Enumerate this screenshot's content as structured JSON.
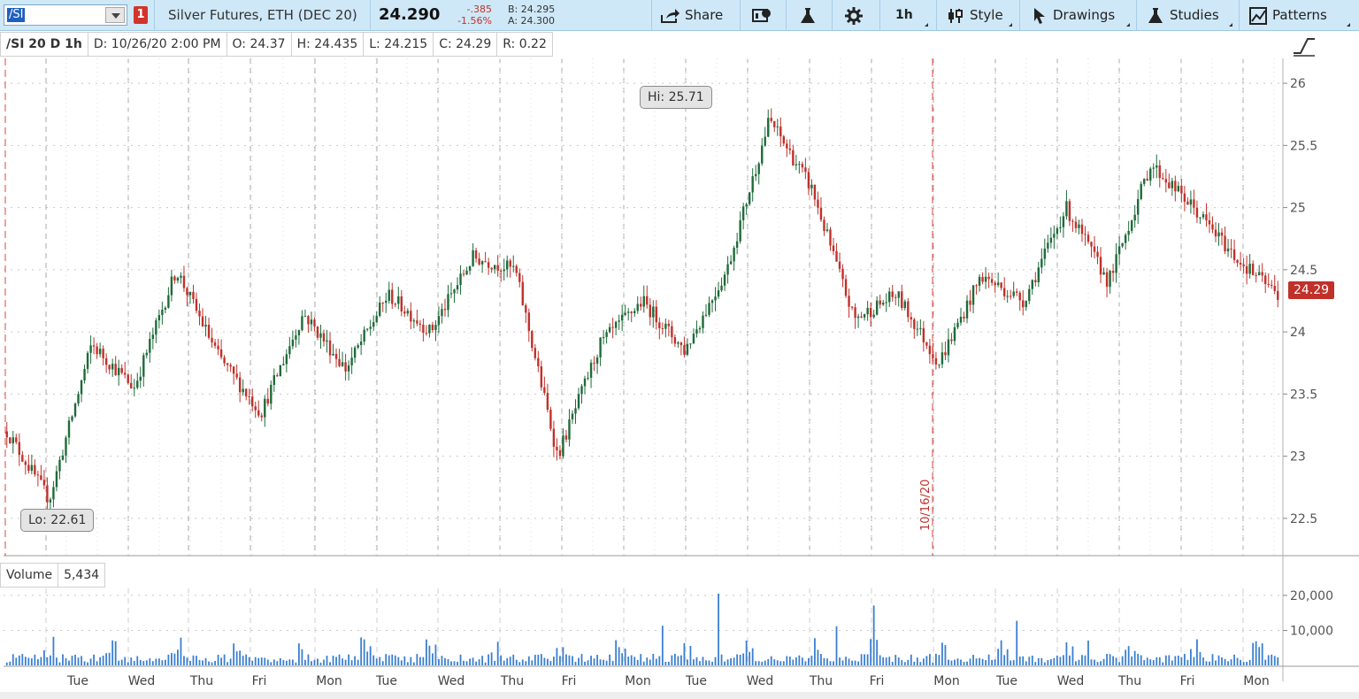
{
  "toolbar": {
    "symbol": "/SI",
    "badge": "1",
    "description": "Silver Futures, ETH (DEC 20)",
    "last": "24.290",
    "net_change": "-.385",
    "pct_change": "-1.56%",
    "bid": "B: 24.295",
    "ask": "A: 24.300",
    "share": "Share",
    "interval": "1h",
    "style": "Style",
    "drawings": "Drawings",
    "studies": "Studies",
    "patterns": "Patterns"
  },
  "infobar": {
    "symbol": "/SI 20 D 1h",
    "date": "D: 10/26/20 2:00 PM",
    "open": "O: 24.37",
    "high": "H: 24.435",
    "low": "L: 24.215",
    "close": "C: 24.29",
    "range": "R: 0.22"
  },
  "annotations": {
    "hi": "Hi: 25.71",
    "lo": "Lo: 22.61",
    "current": "24.29",
    "marker_date": "10/16/20"
  },
  "volume": {
    "label": "Volume",
    "value": "5,434"
  },
  "colors": {
    "up": "#1e6b3a",
    "down": "#c0312a",
    "volume": "#3a7fd0",
    "grid": "#c8c8c8",
    "marker": "#d44"
  },
  "chart_data": {
    "type": "line",
    "title": "",
    "ylim": [
      22.2,
      26.2
    ],
    "y_ticks": [
      "26",
      "25.5",
      "25",
      "24.5",
      "24",
      "23.5",
      "23",
      "22.5"
    ],
    "x_labels": [
      "Tue",
      "Wed",
      "Thu",
      "Fri",
      "Mon",
      "Tue",
      "Wed",
      "Thu",
      "Fri",
      "Mon",
      "Tue",
      "Wed",
      "Thu",
      "Fri",
      "Mon",
      "Tue",
      "Wed",
      "Thu",
      "Fri",
      "Mon"
    ],
    "price_path": [
      23.2,
      22.65,
      23.9,
      23.55,
      24.5,
      23.8,
      23.35,
      24.15,
      23.7,
      24.3,
      24.0,
      24.6,
      24.5,
      23.0,
      23.9,
      24.25,
      23.85,
      24.5,
      25.71,
      25.15,
      24.1,
      24.3,
      23.75,
      24.45,
      24.25,
      25.0,
      24.4,
      25.35,
      25.0,
      24.6,
      24.3
    ],
    "volume_ylim": [
      0,
      22000
    ],
    "volume_ticks": [
      "20,000",
      "10,000"
    ]
  }
}
